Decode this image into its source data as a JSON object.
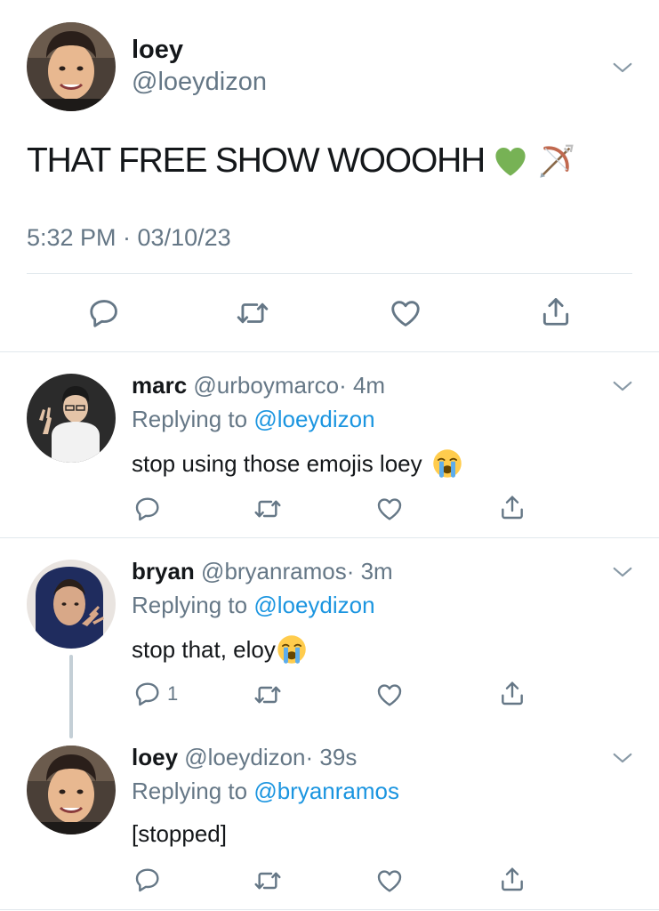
{
  "main_tweet": {
    "name": "loey",
    "handle": "@loeydizon",
    "text": "THAT FREE SHOW WOOOHH",
    "emojis": [
      "green-heart-icon",
      "bow-and-arrow-icon"
    ],
    "timestamp": "5:32 PM · 03/10/23"
  },
  "replies": [
    {
      "name": "marc",
      "handle": "@urboymarco",
      "time": "· 4m",
      "replying_label": "Replying to",
      "replying_to": "@loeydizon",
      "text": "stop using those emojis loey",
      "emoji": "loudly-crying-face-icon",
      "reply_count": ""
    },
    {
      "name": "bryan",
      "handle": "@bryanramos",
      "time": "· 3m",
      "replying_label": "Replying to",
      "replying_to": "@loeydizon",
      "text": "stop that, eloy",
      "emoji": "loudly-crying-face-icon",
      "reply_count": "1"
    },
    {
      "name": "loey",
      "handle": "@loeydizon",
      "time": "· 39s",
      "replying_label": "Replying to",
      "replying_to": "@bryanramos",
      "text": "[stopped]",
      "emoji": "",
      "reply_count": ""
    }
  ],
  "colors": {
    "link": "#1b95e0",
    "muted": "#657786",
    "divider": "#e1e8ed",
    "thread_line": "#c4cfd6"
  }
}
